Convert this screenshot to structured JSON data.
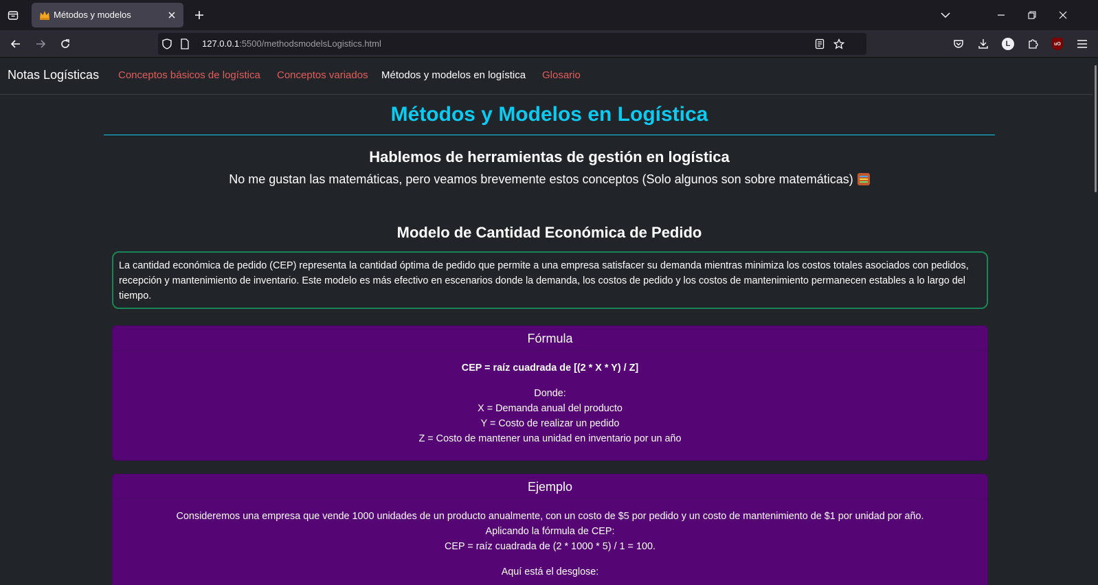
{
  "browser": {
    "tab_title": "Métodos y modelos",
    "url_host": "127.0.0.1",
    "url_path": ":5500/methodsmodelsLogistics.html",
    "profile_initial": "L",
    "ublock_label": "uO"
  },
  "site": {
    "brand": "Notas Logísticas",
    "nav": [
      {
        "label": "Conceptos básicos de logística",
        "active": false
      },
      {
        "label": "Conceptos variados",
        "active": false
      },
      {
        "label": "Métodos y modelos en logística",
        "active": true
      },
      {
        "label": "Glosario",
        "active": false
      }
    ],
    "colors": {
      "link": "#e35d5b",
      "title": "#0dcaf0",
      "card": "#560575",
      "box_border": "#198754",
      "background": "#212529"
    }
  },
  "content": {
    "title": "Métodos y Modelos en Logística",
    "subtitle": "Hablemos de herramientas de gestión en logística",
    "tagline": "No me gustan las matemáticas, pero veamos brevemente estos conceptos (Solo algunos son sobre matemáticas)",
    "section_title": "Modelo de Cantidad Económica de Pedido",
    "intro": "La cantidad económica de pedido (CEP) representa la cantidad óptima de pedido que permite a una empresa satisfacer su demanda mientras minimiza los costos totales asociados con pedidos, recepción y mantenimiento de inventario. Este modelo es más efectivo en escenarios donde la demanda, los costos de pedido y los costos de mantenimiento permanecen estables a lo largo del tiempo.",
    "formula_card": {
      "header": "Fórmula",
      "formula": "CEP = raíz cuadrada de [(2 * X * Y) / Z]",
      "where": "Donde:",
      "lines": [
        "X = Demanda anual del producto",
        "Y = Costo de realizar un pedido",
        "Z = Costo de mantener una unidad en inventario por un año"
      ]
    },
    "example_card": {
      "header": "Ejemplo",
      "lines": [
        "Consideremos una empresa que vende 1000 unidades de un producto anualmente, con un costo de $5 por pedido y un costo de mantenimiento de $1 por unidad por año.",
        "Aplicando la fórmula de CEP:",
        "CEP = raíz cuadrada de (2 * 1000 * 5) / 1 = 100."
      ],
      "breakdown": "Aquí está el desglose:"
    }
  }
}
